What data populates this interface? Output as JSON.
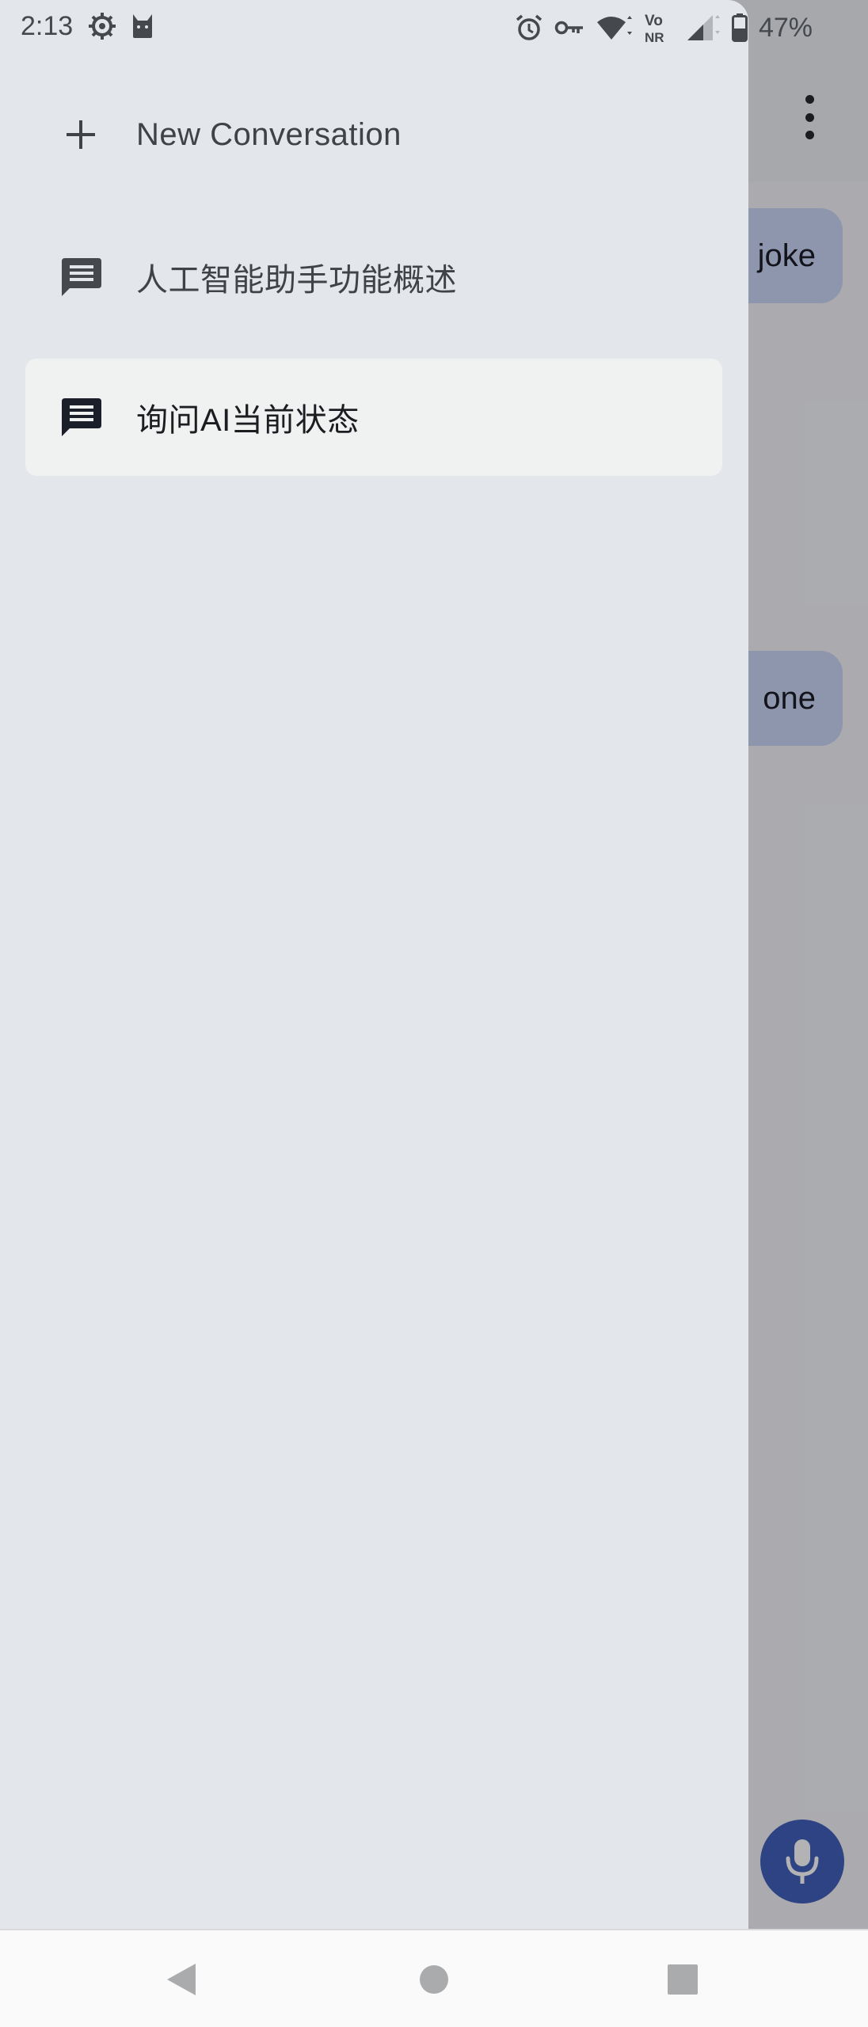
{
  "status_bar": {
    "time": "2:13",
    "battery_percent": "47%",
    "left_icons": [
      "settings-gear-icon",
      "cat-icon"
    ],
    "right_icons": [
      "alarm-icon",
      "vpn-key-icon",
      "wifi-icon",
      "vonr-icon",
      "signal-icon",
      "battery-icon"
    ]
  },
  "drawer": {
    "new_conversation_label": "New Conversation",
    "conversations": [
      {
        "label": "人工智能助手功能概述",
        "selected": false
      },
      {
        "label": "询问AI当前状态",
        "selected": true
      }
    ]
  },
  "background_chat": {
    "bubble_1_text": "joke",
    "bubble_2_text": "one"
  },
  "colors": {
    "drawer_bg": "#e3e7eb",
    "selected_item_bg": "#f0f2f2",
    "user_bubble": "#c9d4f3",
    "mic_fab": "#3b5bb5",
    "scrim": "rgba(20,20,24,0.32)"
  },
  "nav_bar": {
    "icons": [
      "back-icon",
      "home-icon",
      "recents-icon"
    ]
  }
}
